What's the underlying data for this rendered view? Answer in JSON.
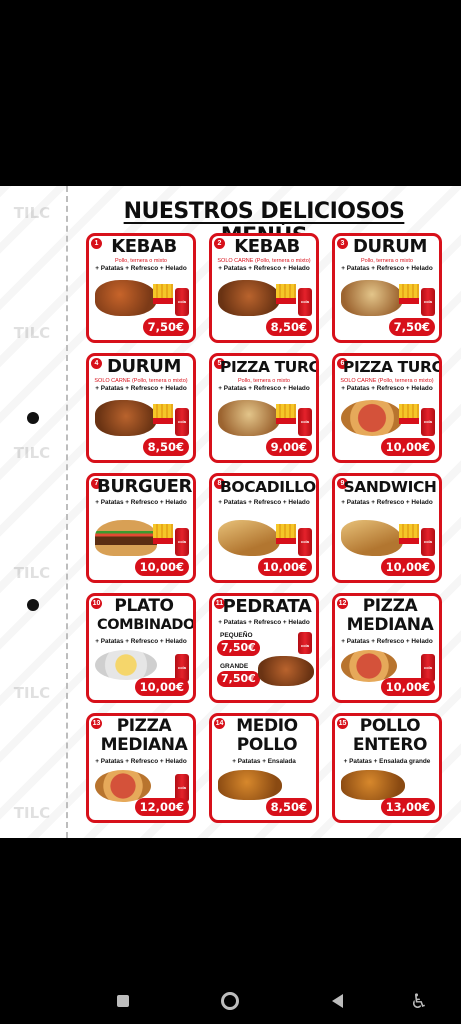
{
  "menu": {
    "title": "NUESTROS DELICIOSOS MENÚS",
    "items": [
      {
        "num": "1",
        "name": "KEBAB",
        "sub": "Pollo, ternera o mixto",
        "extras": "+ Patatas + Refresco + Helado",
        "price": "7,50€"
      },
      {
        "num": "2",
        "name": "KEBAB",
        "sub": "SOLO CARNE (Pollo, ternera o mixto)",
        "extras": "+ Patatas + Refresco + Helado",
        "price": "8,50€"
      },
      {
        "num": "3",
        "name": "DURUM",
        "sub": "Pollo, ternera o mixto",
        "extras": "+ Patatas + Refresco + Helado",
        "price": "7,50€"
      },
      {
        "num": "4",
        "name": "DURUM",
        "sub": "SOLO CARNE (Pollo, ternera o mixto)",
        "extras": "+ Patatas + Refresco + Helado",
        "price": "8,50€"
      },
      {
        "num": "5",
        "name": "PIZZA TURCA",
        "sub": "Pollo, ternera o mixto",
        "extras": "+ Patatas + Refresco + Helado",
        "price": "9,00€"
      },
      {
        "num": "6",
        "name": "PIZZA TURCA",
        "sub": "SOLO CARNE (Pollo, ternera o mixto)",
        "extras": "+ Patatas + Refresco + Helado",
        "price": "10,00€"
      },
      {
        "num": "7",
        "name": "BURGUER",
        "sub": "",
        "extras": "+ Patatas + Refresco + Helado",
        "price": "10,00€"
      },
      {
        "num": "8",
        "name": "BOCADILLO",
        "sub": "",
        "extras": "+ Patatas + Refresco + Helado",
        "price": "10,00€"
      },
      {
        "num": "9",
        "name": "SANDWICH",
        "sub": "",
        "extras": "+ Patatas + Refresco + Helado",
        "price": "10,00€"
      },
      {
        "num": "10",
        "name_line1": "PLATO",
        "name_line2": "COMBINADO",
        "extras": "+ Patatas + Refresco + Helado",
        "price": "10,00€"
      },
      {
        "num": "11",
        "name": "PEDRATA",
        "extras": "+ Patatas + Refresco + Helado",
        "size_small": "PEQUEÑO",
        "price_small": "7,50€",
        "size_large": "GRANDE",
        "price_large": "7,50€"
      },
      {
        "num": "12",
        "name_line1": "PIZZA",
        "name_line2": "MEDIANA",
        "extras": "+ Patatas + Refresco + Helado",
        "price": "10,00€"
      },
      {
        "num": "13",
        "name_line1": "PIZZA",
        "name_line2": "MEDIANA",
        "extras": "+ Patatas + Refresco + Helado",
        "price": "12,00€"
      },
      {
        "num": "14",
        "name_line1": "MEDIO",
        "name_line2": "POLLO",
        "extras": "+ Patatas + Ensalada",
        "price": "8,50€"
      },
      {
        "num": "15",
        "name_line1": "POLLO",
        "name_line2": "ENTERO",
        "extras": "+ Patatas + Ensalada grande",
        "price": "13,00€"
      }
    ]
  },
  "colors": {
    "accent": "#d7101a",
    "background": "#ffffff"
  },
  "nav": {
    "icons": [
      "recents-icon",
      "home-icon",
      "back-icon",
      "accessibility-icon"
    ]
  }
}
